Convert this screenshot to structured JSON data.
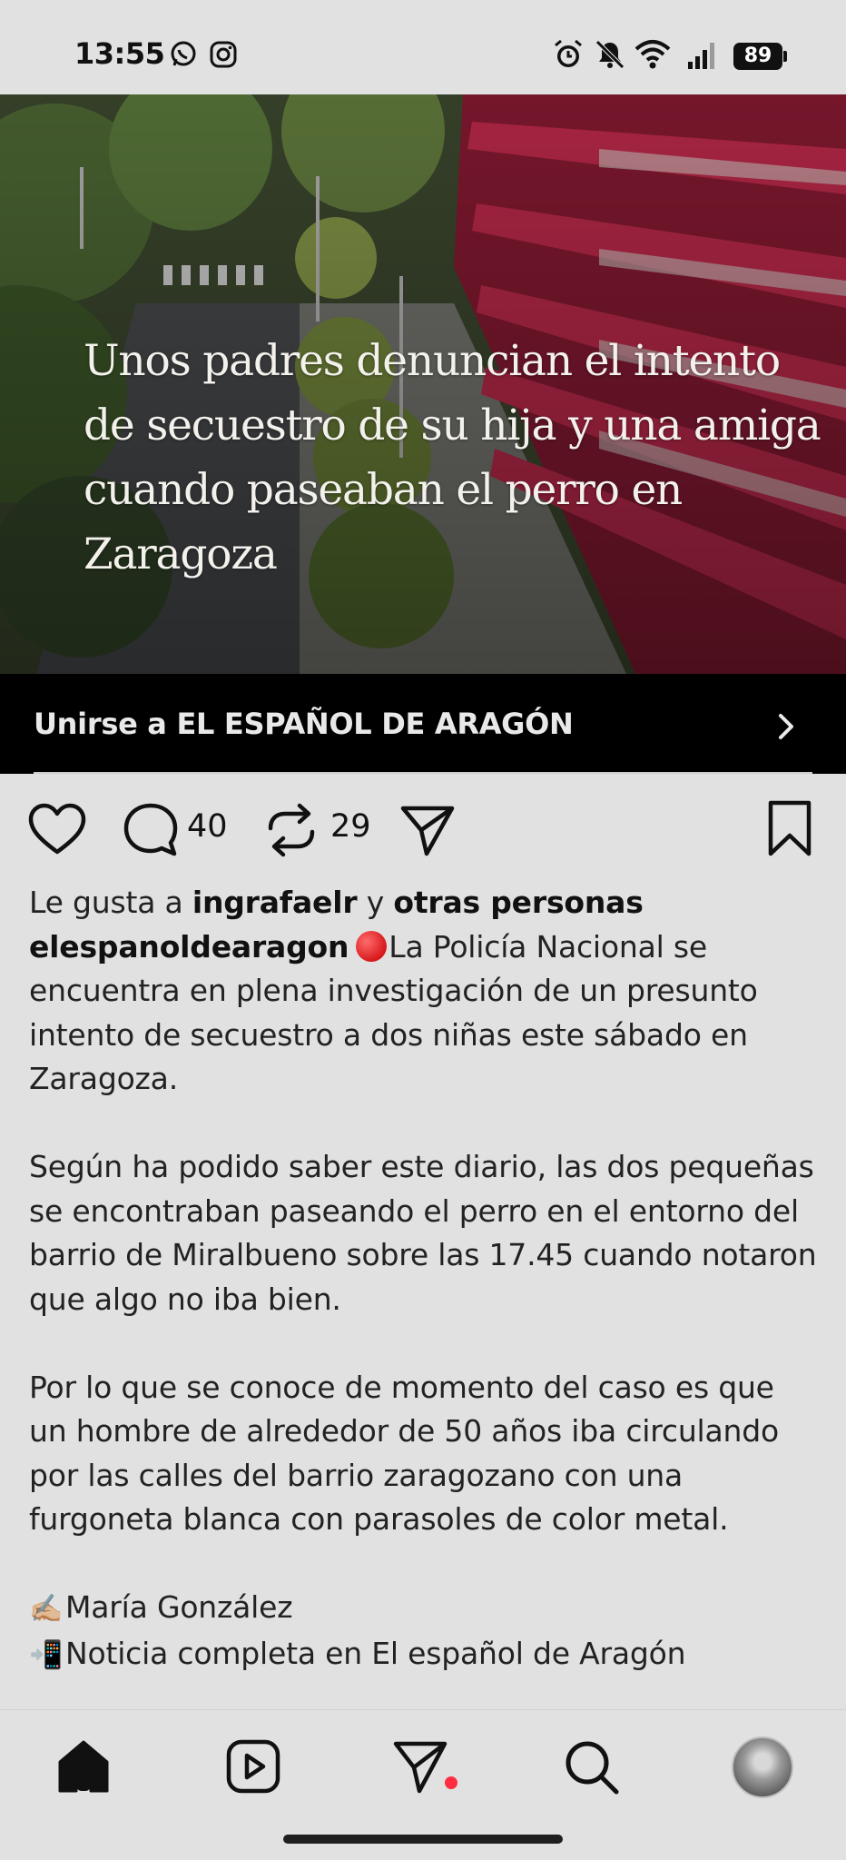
{
  "status_bar": {
    "time": "13:55",
    "battery": "89",
    "left_icons": [
      "whatsapp-icon",
      "instagram-icon"
    ],
    "right_icons": [
      "alarm-icon",
      "bell-muted-icon",
      "wifi-icon",
      "signal-icon",
      "battery-icon"
    ]
  },
  "post": {
    "hero_title": "Unos padres denuncian el intento de secuestro de su hija y una amiga cuando paseaban el perro en Zaragoza",
    "join_banner": "Unirse a EL ESPAÑOL DE ARAGÓN",
    "actions": {
      "comments_count": "40",
      "reposts_count": "29"
    },
    "likes": {
      "prefix": "Le gusta a",
      "user": "ingrafaelr",
      "connector": "y",
      "others": "otras personas"
    },
    "caption": {
      "author": "elespanoldearagon",
      "p1": "La Policía Nacional se encuentra en plena investigación de un presunto intento de secuestro a dos niñas este sábado en Zaragoza.",
      "p2": "Según ha podido saber este diario, las dos pequeñas se encontraban paseando el perro en el entorno del barrio de Miralbueno sobre las 17.45 cuando notaron que algo no iba bien.",
      "p3": "Por lo que se conoce de momento del caso es que un hombre de alrededor de 50 años iba circulando por las calles del barrio zaragozano con una furgoneta blanca con parasoles de color metal.",
      "writer_emoji": "✍🏼",
      "writer": "María González",
      "link_emoji": "📲",
      "link_text": "Noticia completa en El español de Aragón"
    }
  },
  "nav": {
    "items": [
      "home-icon",
      "reels-icon",
      "messages-icon",
      "search-icon",
      "profile-avatar"
    ]
  },
  "colors": {
    "background": "#e1e1e1",
    "banner": "#000000",
    "notification": "#ff2d3f",
    "building_red": "#a01c3a"
  }
}
